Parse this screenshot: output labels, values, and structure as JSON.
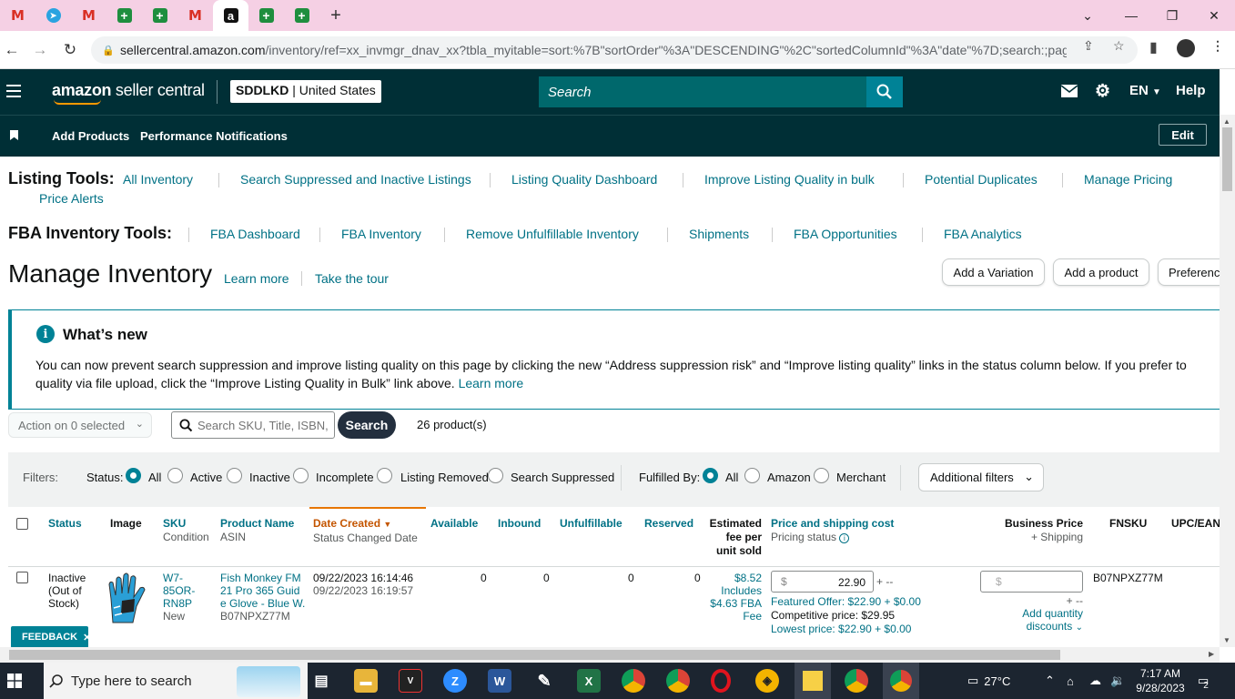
{
  "browser": {
    "url_host": "sellercentral.amazon.com",
    "url_path": "/inventory/ref=xx_invmgr_dnav_xx?tbla_myitable=sort:%7B\"sortOrder\"%3A\"DESCENDING\"%2C\"sortedColumnId\"%3A\"date\"%7D;search:;pagin...",
    "new_tab": "+"
  },
  "header": {
    "logo_bold": "amazon",
    "logo_rest": " seller central",
    "store_code": "SDDLKD",
    "store_region": " | United States",
    "search_placeholder": "Search",
    "language": "EN",
    "help": "Help"
  },
  "nav": {
    "add_products": "Add Products",
    "performance_notifications": "Performance Notifications",
    "edit": "Edit"
  },
  "listing_tools": {
    "label": "Listing Tools:",
    "links": [
      "All Inventory",
      "Search Suppressed and Inactive Listings",
      "Listing Quality Dashboard",
      "Improve Listing Quality in bulk",
      "Potential Duplicates",
      "Manage Pricing",
      "Price Alerts"
    ]
  },
  "fba_tools": {
    "label": "FBA Inventory Tools:",
    "links": [
      "FBA Dashboard",
      "FBA Inventory",
      "Remove Unfulfillable Inventory",
      "Shipments",
      "FBA Opportunities",
      "FBA Analytics"
    ]
  },
  "page": {
    "title": "Manage Inventory",
    "learn_more": "Learn more",
    "take_tour": "Take the tour",
    "add_variation": "Add a Variation",
    "add_product": "Add a product",
    "preferences": "Preferences"
  },
  "whats_new": {
    "title": "What’s new",
    "line1": "You can now prevent search suppression and improve listing quality on this page by clicking the new “Address suppression risk” and “Improve listing quality” links in the status column below. If you prefer to",
    "line2": "quality via file upload, click the “Improve Listing Quality in Bulk” link above.",
    "learn_more": "Learn more"
  },
  "actions": {
    "action_select": "Action on 0 selected",
    "search_placeholder": "Search SKU, Title, ISBN,",
    "search_button": "Search",
    "product_count": "26 product(s)"
  },
  "filters": {
    "label": "Filters:",
    "status_label": "Status:",
    "status_options": [
      "All",
      "Active",
      "Inactive",
      "Incomplete",
      "Listing Removed",
      "Search Suppressed"
    ],
    "status_selected": "All",
    "fulfilled_label": "Fulfilled By:",
    "fulfilled_options": [
      "All",
      "Amazon",
      "Merchant"
    ],
    "fulfilled_selected": "All",
    "additional": "Additional filters"
  },
  "table": {
    "headers": {
      "status": "Status",
      "image": "Image",
      "sku": "SKU",
      "sku_sub": "Condition",
      "product_name": "Product Name",
      "product_sub": "ASIN",
      "date_created": "Date Created",
      "date_sub": "Status Changed Date",
      "available": "Available",
      "inbound": "Inbound",
      "unfulfillable": "Unfulfillable",
      "reserved": "Reserved",
      "fee_l1": "Estimated",
      "fee_l2": "fee per",
      "fee_l3": "unit sold",
      "price": "Price and shipping cost",
      "price_sub": "Pricing status",
      "business_price": "Business Price",
      "business_sub": "+ Shipping",
      "fnsku": "FNSKU",
      "upc": "UPC/EAN"
    },
    "rows": [
      {
        "status_l1": "Inactive",
        "status_l2": "(Out of",
        "status_l3": "Stock)",
        "sku_l1": "W7-",
        "sku_l2": "85OR-",
        "sku_l3": "RN8P",
        "condition": "New",
        "name_l1": "Fish Monkey FM",
        "name_l2": "21 Pro 365 Guid",
        "name_l3": "e Glove - Blue W.",
        "asin": "B07NPXZ77M",
        "date_created": "09/22/2023 16:14:46",
        "status_changed": "09/22/2023 16:19:57",
        "available": "0",
        "inbound": "0",
        "unfulfillable": "0",
        "reserved": "0",
        "fee": "$8.52",
        "fee_l2": "Includes",
        "fee_l3": "$4.63 FBA",
        "fee_l4": "Fee",
        "currency": "$",
        "price": "22.90",
        "price_suffix": "+ --",
        "featured": "Featured Offer: $22.90 + $0.00",
        "competitive": "Competitive price: $29.95",
        "lowest": "Lowest price: $22.90 + $0.00",
        "business_currency": "$",
        "business_suffix": "+ --",
        "add_qty_l1": "Add quantity",
        "add_qty_l2": "discounts",
        "fnsku": "B07NPXZ77M"
      }
    ]
  },
  "feedback": "FEEDBACK",
  "taskbar": {
    "search_placeholder": "Type here to search",
    "temperature": "27°C",
    "time": "7:17 AM",
    "date": "9/28/2023",
    "notifications": "2"
  }
}
